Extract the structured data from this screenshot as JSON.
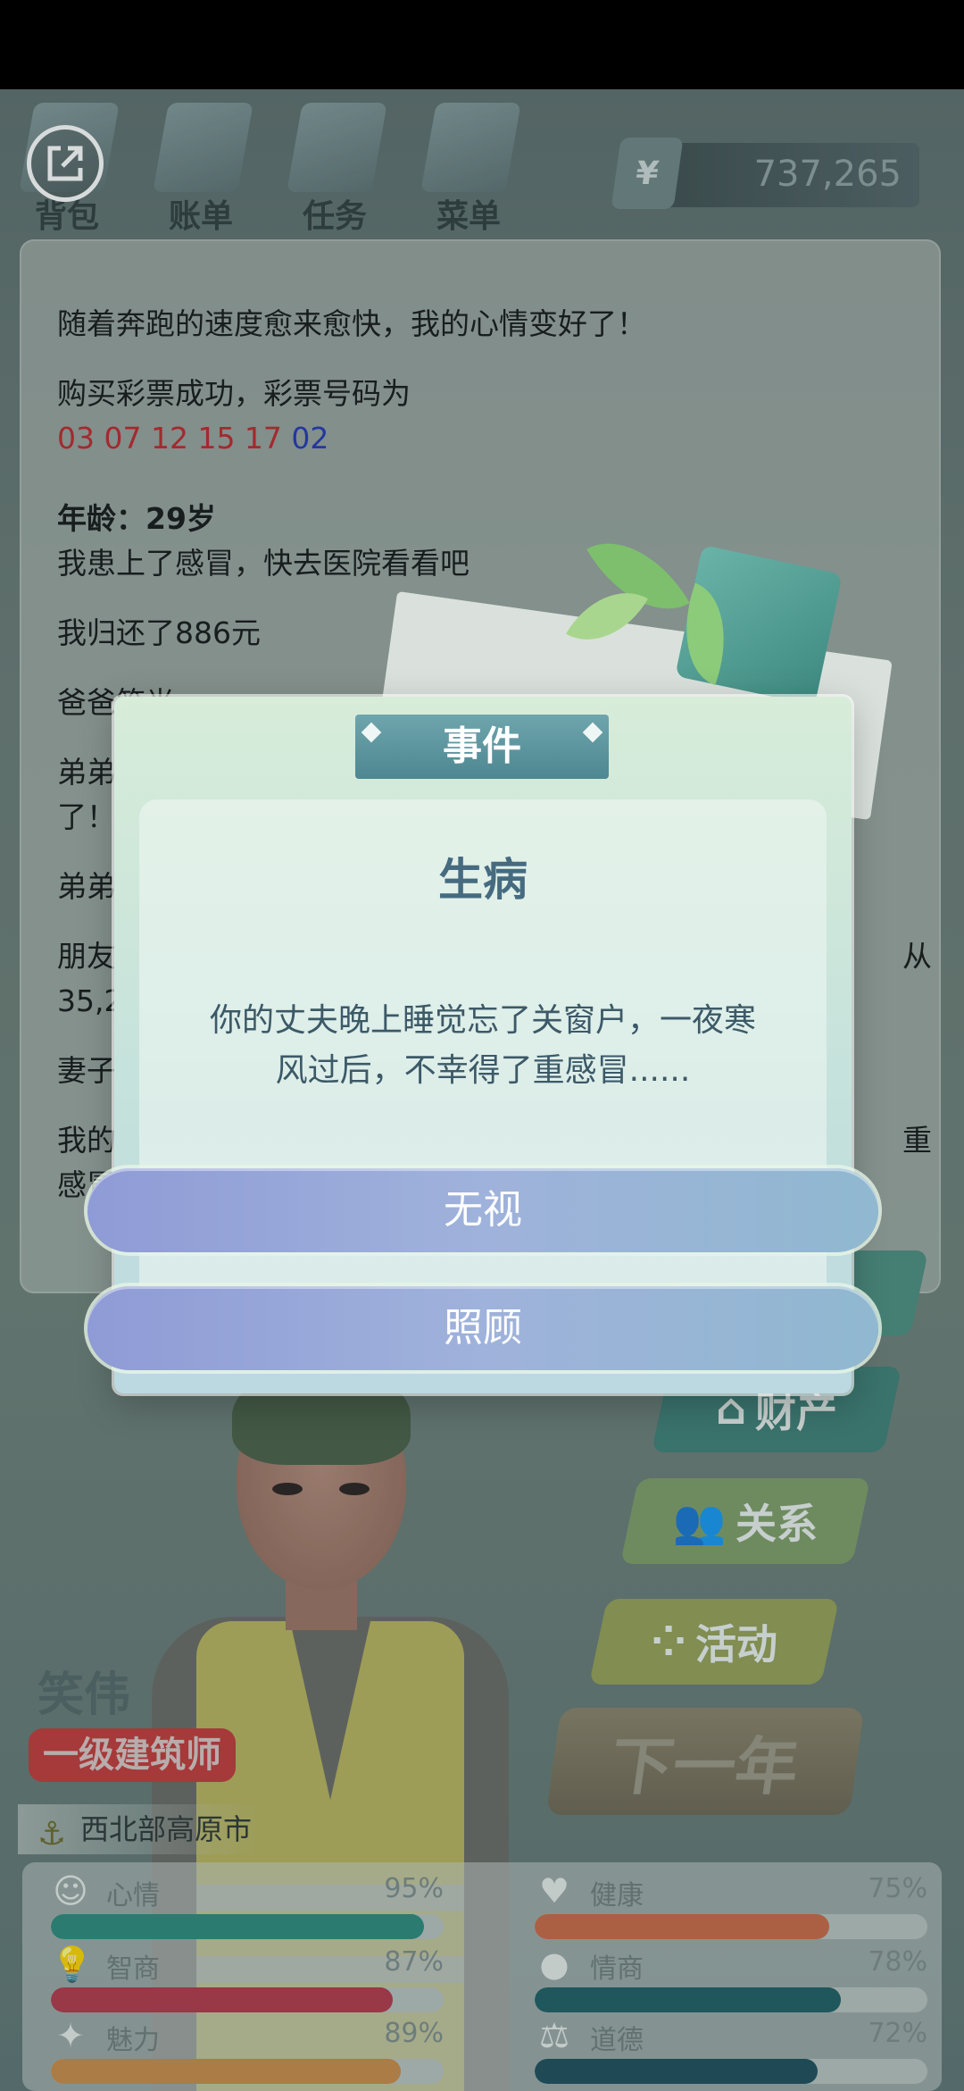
{
  "nav": {
    "items": [
      {
        "label": "背包"
      },
      {
        "label": "账单"
      },
      {
        "label": "任务"
      },
      {
        "label": "菜单"
      }
    ],
    "money": {
      "symbol": "¥",
      "value": "737,265"
    }
  },
  "log": {
    "line1": "随着奔跑的速度愈来愈快，我的心情变好了！",
    "lottery_label": "购买彩票成功，彩票号码为",
    "lottery_red": "03 07 12 15 17",
    "lottery_blue": "02",
    "age_label": "年龄：29岁",
    "sick_line": "我患上了感冒，快去医院看看吧",
    "repay_line": "我归还了886元",
    "dad_line": "爸爸笑光",
    "bro1_a": "弟弟",
    "bro1_b": "了！",
    "bro2": "弟弟",
    "friend_a": "朋友",
    "friend_a_right": "从",
    "friend_b": "35,2",
    "wife": "妻子",
    "my_a": "我的",
    "my_a_right": "重",
    "my_b": "感冒"
  },
  "side_buttons": [
    {
      "label": "财产",
      "icon": "home-icon"
    },
    {
      "label": "关系",
      "icon": "people-icon"
    },
    {
      "label": "活动",
      "icon": "bubbles-icon"
    }
  ],
  "next_year": "下一年",
  "profile": {
    "name": "笑伟",
    "job": "一级建筑师",
    "location": "西北部高原市"
  },
  "stats": [
    {
      "label": "心情",
      "pct": "95%",
      "value": 0.95,
      "color": "#2e8a7e",
      "icon": "smile-icon"
    },
    {
      "label": "健康",
      "pct": "75%",
      "value": 0.75,
      "color": "#c96a46",
      "icon": "heart-icon"
    },
    {
      "label": "智商",
      "pct": "87%",
      "value": 0.87,
      "color": "#b3394b",
      "icon": "bulb-icon"
    },
    {
      "label": "情商",
      "pct": "78%",
      "value": 0.78,
      "color": "#1f5f66",
      "icon": "apple-icon"
    },
    {
      "label": "魅力",
      "pct": "89%",
      "value": 0.89,
      "color": "#c98c4a",
      "icon": "sparkle-icon"
    },
    {
      "label": "道德",
      "pct": "72%",
      "value": 0.72,
      "color": "#1e4f5c",
      "icon": "scale-icon"
    }
  ],
  "modal": {
    "tab": "事件",
    "title": "生病",
    "text_line1": "你的丈夫晚上睡觉忘了关窗户，一夜寒",
    "text_line2": "风过后，不幸得了重感冒......",
    "btn_ignore": "无视",
    "btn_care": "照顾"
  }
}
